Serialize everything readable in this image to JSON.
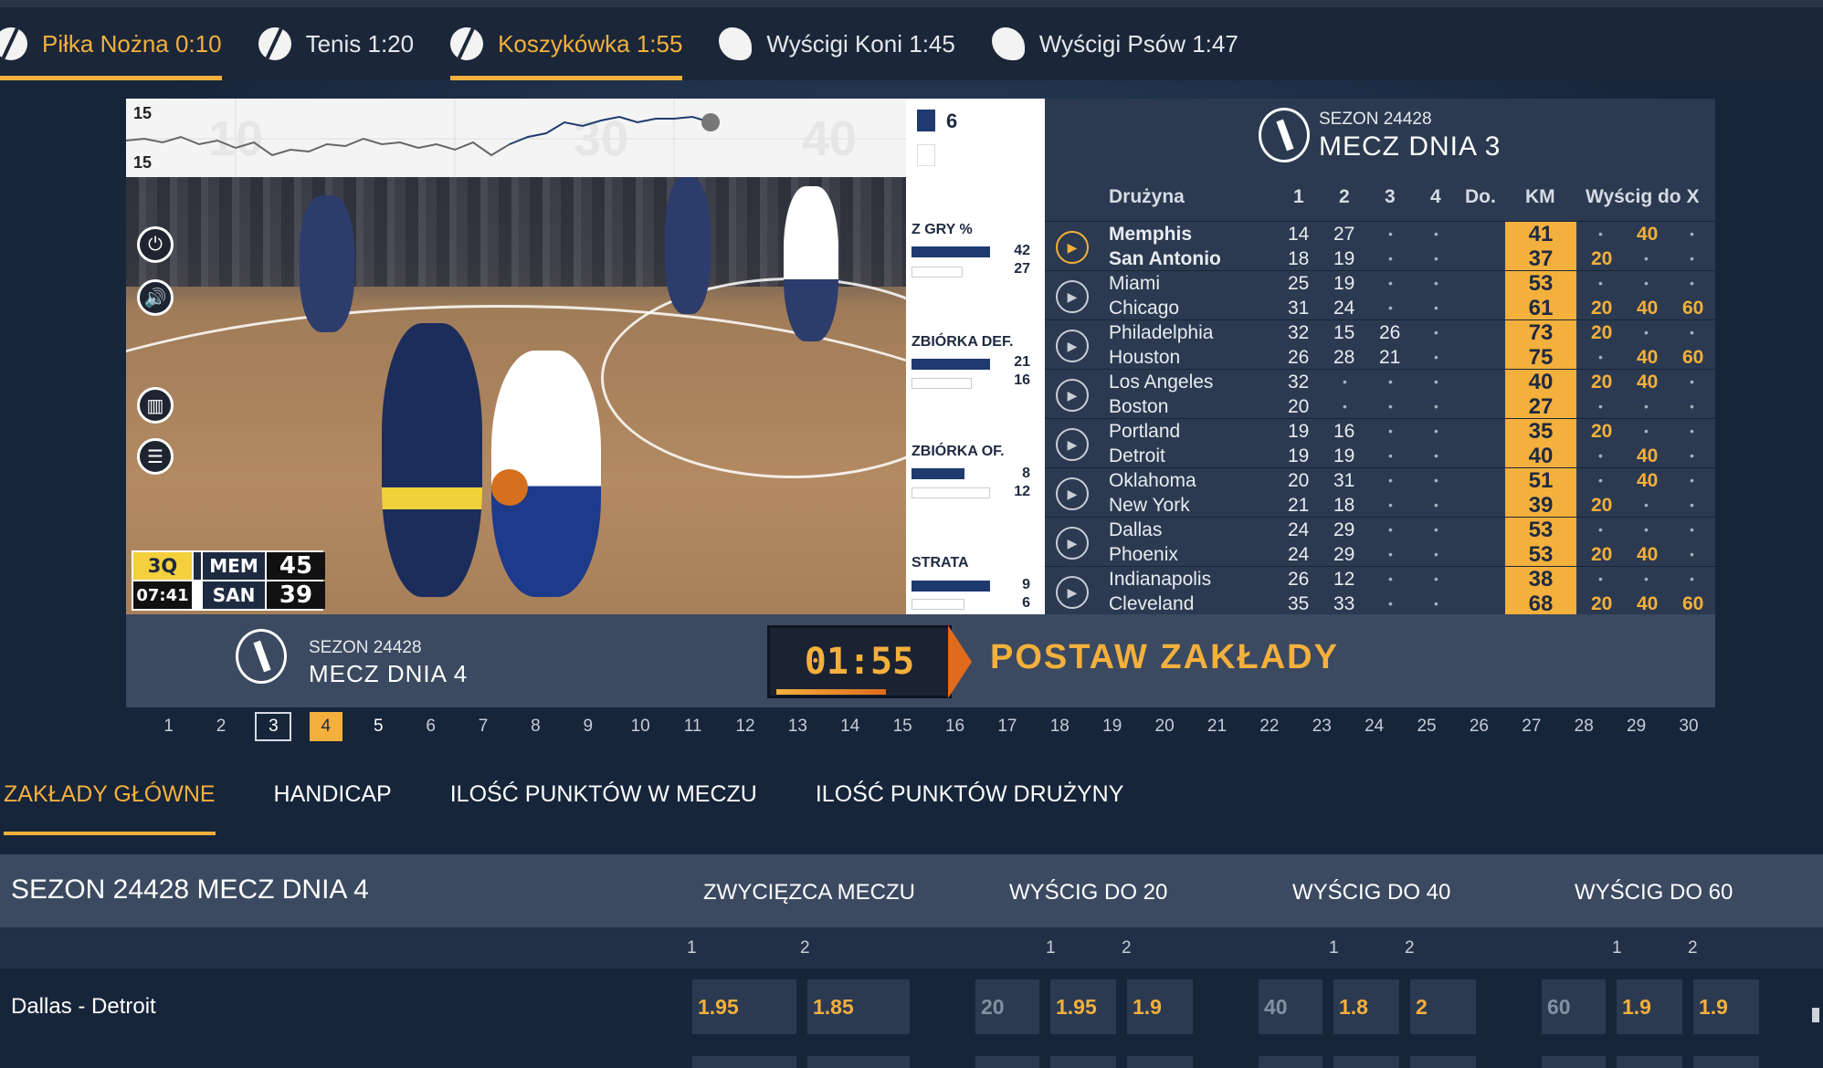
{
  "sports_tabs": [
    {
      "label": "Piłka Nożna 0:10",
      "icon": "soccer-ball-icon",
      "active": true
    },
    {
      "label": "Tenis 1:20",
      "icon": "tennis-ball-icon",
      "active": false
    },
    {
      "label": "Koszykówka 1:55",
      "icon": "basketball-icon",
      "active": true
    },
    {
      "label": "Wyścigi Koni 1:45",
      "icon": "horse-icon",
      "active": false
    },
    {
      "label": "Wyścigi Psów 1:47",
      "icon": "dog-icon",
      "active": false
    }
  ],
  "video": {
    "graph_top": "15",
    "graph_bottom": "15",
    "graph_watermarks": [
      "10",
      "30",
      "40"
    ],
    "scoreboard": {
      "quarter": "3Q",
      "clock": "07:41",
      "team1": "MEM",
      "score1": "45",
      "team2": "SAN",
      "score2": "39"
    },
    "controls": [
      "power-icon",
      "volume-icon",
      "stats-icon",
      "list-icon"
    ]
  },
  "stats": {
    "fouls_value": "6",
    "items": [
      {
        "label": "Z GRY %",
        "v1": "42",
        "v2": "27"
      },
      {
        "label": "ZBIÓRKA DEF.",
        "v1": "21",
        "v2": "16"
      },
      {
        "label": "ZBIÓRKA OF.",
        "v1": "8",
        "v2": "12"
      },
      {
        "label": "STRATA",
        "v1": "9",
        "v2": "6"
      }
    ]
  },
  "table": {
    "season": "SEZON 24428",
    "matchday": "MECZ DNIA 3",
    "headers": {
      "team": "Drużyna",
      "q1": "1",
      "q2": "2",
      "q3": "3",
      "q4": "4",
      "ot": "Do.",
      "km": "KM",
      "race": "Wyścig do X"
    },
    "rows": [
      {
        "t1": "Memphis",
        "t2": "San Antonio",
        "a": [
          "14",
          "27",
          "•",
          "•"
        ],
        "b": [
          "18",
          "19",
          "•",
          "•"
        ],
        "km1": "41",
        "km2": "37",
        "r1": [
          "•",
          "40",
          "•"
        ],
        "r2": [
          "20",
          "•",
          "•"
        ],
        "active": true
      },
      {
        "t1": "Miami",
        "t2": "Chicago",
        "a": [
          "25",
          "19",
          "•",
          "•"
        ],
        "b": [
          "31",
          "24",
          "•",
          "•"
        ],
        "km1": "53",
        "km2": "61",
        "r1": [
          "•",
          "•",
          "•"
        ],
        "r2": [
          "20",
          "40",
          "60"
        ],
        "active": false
      },
      {
        "t1": "Philadelphia",
        "t2": "Houston",
        "a": [
          "32",
          "15",
          "26",
          "•"
        ],
        "b": [
          "26",
          "28",
          "21",
          "•"
        ],
        "km1": "73",
        "km2": "75",
        "r1": [
          "20",
          "•",
          "•"
        ],
        "r2": [
          "•",
          "40",
          "60"
        ],
        "active": false
      },
      {
        "t1": "Los Angeles",
        "t2": "Boston",
        "a": [
          "32",
          "•",
          "•",
          "•"
        ],
        "b": [
          "20",
          "•",
          "•",
          "•"
        ],
        "km1": "40",
        "km2": "27",
        "r1": [
          "20",
          "40",
          "•"
        ],
        "r2": [
          "•",
          "•",
          "•"
        ],
        "active": false
      },
      {
        "t1": "Portland",
        "t2": "Detroit",
        "a": [
          "19",
          "16",
          "•",
          "•"
        ],
        "b": [
          "19",
          "19",
          "•",
          "•"
        ],
        "km1": "35",
        "km2": "40",
        "r1": [
          "20",
          "•",
          "•"
        ],
        "r2": [
          "•",
          "40",
          "•"
        ],
        "active": false
      },
      {
        "t1": "Oklahoma",
        "t2": "New York",
        "a": [
          "20",
          "31",
          "•",
          "•"
        ],
        "b": [
          "21",
          "18",
          "•",
          "•"
        ],
        "km1": "51",
        "km2": "39",
        "r1": [
          "•",
          "40",
          "•"
        ],
        "r2": [
          "20",
          "•",
          "•"
        ],
        "active": false
      },
      {
        "t1": "Dallas",
        "t2": "Phoenix",
        "a": [
          "24",
          "29",
          "•",
          "•"
        ],
        "b": [
          "24",
          "29",
          "•",
          "•"
        ],
        "km1": "53",
        "km2": "53",
        "r1": [
          "•",
          "•",
          "•"
        ],
        "r2": [
          "20",
          "40",
          "•"
        ],
        "active": false
      },
      {
        "t1": "Indianapolis",
        "t2": "Cleveland",
        "a": [
          "26",
          "12",
          "•",
          "•"
        ],
        "b": [
          "35",
          "33",
          "•",
          "•"
        ],
        "km1": "38",
        "km2": "68",
        "r1": [
          "•",
          "•",
          "•"
        ],
        "r2": [
          "20",
          "40",
          "60"
        ],
        "active": false
      }
    ]
  },
  "betbar": {
    "season": "SEZON 24428",
    "matchday": "MECZ DNIA 4",
    "timer": "01:55",
    "cta": "POSTAW ZAKŁADY"
  },
  "match_numbers": [
    "1",
    "2",
    "3",
    "4",
    "5",
    "6",
    "7",
    "8",
    "9",
    "10",
    "11",
    "12",
    "13",
    "14",
    "15",
    "16",
    "17",
    "18",
    "19",
    "20",
    "21",
    "22",
    "23",
    "24",
    "25",
    "26",
    "27",
    "28",
    "29",
    "30"
  ],
  "match_current": "3",
  "match_selected": "4",
  "market_tabs": [
    "ZAKŁADY GŁÓWNE",
    "HANDICAP",
    "ILOŚĆ PUNKTÓW W MECZU",
    "ILOŚĆ PUNKTÓW DRUŻYNY"
  ],
  "markets": {
    "section_title": "SEZON 24428 MECZ DNIA 4",
    "titles": [
      "ZWYCIĘZCA MECZU",
      "WYŚCIG DO 20",
      "WYŚCIG DO 40",
      "WYŚCIG DO 60"
    ],
    "sub_labels": [
      "1",
      "2"
    ],
    "match": "Dallas - Detroit",
    "winner": [
      "1.95",
      "1.85"
    ],
    "race20": {
      "line": "20",
      "o1": "1.95",
      "o2": "1.9"
    },
    "race40": {
      "line": "40",
      "o1": "1.8",
      "o2": "2"
    },
    "race60": {
      "line": "60",
      "o1": "1.9",
      "o2": "1.9"
    }
  },
  "colors": {
    "accent": "#f4b03c",
    "panel": "#2b3a50",
    "bg": "#17253a",
    "bar": "#1e3a6e"
  }
}
